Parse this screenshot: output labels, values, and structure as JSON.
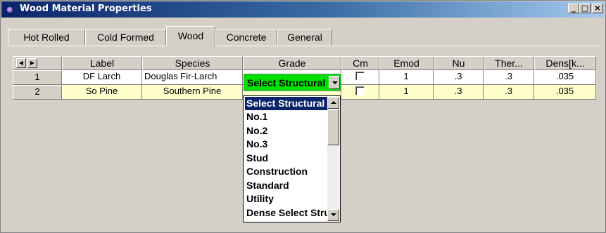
{
  "window": {
    "title": "Wood Material Properties",
    "controls": {
      "minimize": "_",
      "maximize": "□",
      "close": "×"
    }
  },
  "tabs": [
    {
      "label": "Hot Rolled",
      "active": false
    },
    {
      "label": "Cold Formed",
      "active": false
    },
    {
      "label": "Wood",
      "active": true
    },
    {
      "label": "Concrete",
      "active": false
    },
    {
      "label": "General",
      "active": false
    }
  ],
  "table": {
    "nav": {
      "prev": "◀",
      "next": "▶"
    },
    "columns": [
      "Label",
      "Species",
      "Grade",
      "Cm",
      "Emod",
      "Nu",
      "Ther...",
      "Dens[k..."
    ],
    "rows": [
      {
        "num": "1",
        "label": "DF Larch",
        "species": "Douglas Fir-Larch",
        "grade": "Select Structural",
        "cm": false,
        "emod": "1",
        "nu": ".3",
        "ther": ".3",
        "dens": ".035"
      },
      {
        "num": "2",
        "label": "So Pine",
        "species": "Southern Pine",
        "grade": "",
        "cm": false,
        "emod": "1",
        "nu": ".3",
        "ther": ".3",
        "dens": ".035"
      }
    ]
  },
  "grade_dropdown": {
    "selected": "Select Structural",
    "options": [
      "Select Structural",
      "No.1",
      "No.2",
      "No.3",
      "Stud",
      "Construction",
      "Standard",
      "Utility",
      "Dense Select Structural"
    ]
  },
  "colors": {
    "active_cell": "#00e000",
    "row_highlight": "#ffffcc",
    "selection": "#0a246a"
  }
}
